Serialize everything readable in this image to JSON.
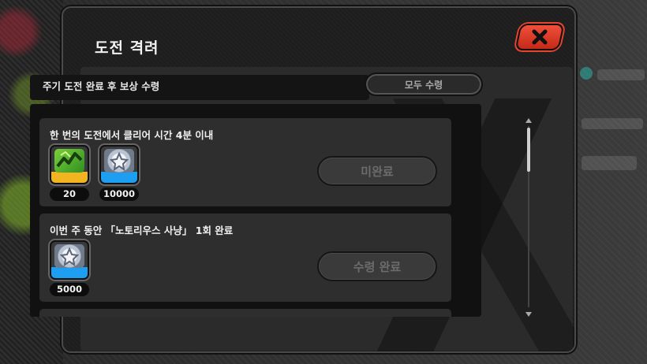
{
  "popup": {
    "title": "도전 격려",
    "close_label": "✕"
  },
  "header": {
    "text": "주기 도전 완료 후 보상 수령",
    "claim_all_label": "모두 수령"
  },
  "missions": [
    {
      "title": "한 번의 도전에서 클리어 시간 4분 이내",
      "rewards": [
        {
          "icon": "green-crystal-icon",
          "count": "20"
        },
        {
          "icon": "silver-coin-icon",
          "count": "10000"
        }
      ],
      "status": "미완료"
    },
    {
      "title": "이번 주 동안 「노토리우스 사냥」 1회 완료",
      "rewards": [
        {
          "icon": "silver-coin-icon",
          "count": "5000"
        }
      ],
      "status": "수령 완료"
    }
  ],
  "colors": {
    "close_button": "#e8452f",
    "reward_gold": "#f3b421",
    "reward_blue": "#1e9ef0"
  }
}
